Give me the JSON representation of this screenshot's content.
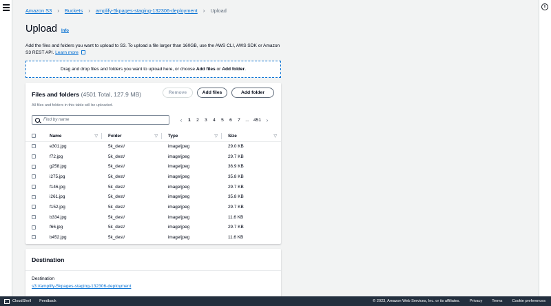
{
  "breadcrumb": {
    "items": [
      "Amazon S3",
      "Buckets",
      "amplify-5kpages-staging-132306-deployment"
    ],
    "current": "Upload"
  },
  "page": {
    "title": "Upload",
    "info": "Info",
    "description": "Add the files and folders you want to upload to S3. To upload a file larger than 160GB, use the AWS CLI, AWS SDK or Amazon S3 REST API.",
    "learn_more": "Learn more"
  },
  "dropzone": {
    "text_before": "Drag and drop files and folders you want to upload here, or choose ",
    "add_files": "Add files",
    "or": " or ",
    "add_folder": "Add folder",
    "period": "."
  },
  "files_panel": {
    "title": "Files and folders",
    "count": "(4501 Total, 127.9 MB)",
    "subtitle": "All files and folders in this table will be uploaded.",
    "buttons": {
      "remove": "Remove",
      "add_files": "Add files",
      "add_folder": "Add folder"
    },
    "search_placeholder": "Find by name",
    "pagination": {
      "pages": [
        "1",
        "2",
        "3",
        "4",
        "5",
        "6",
        "7"
      ],
      "ellipsis": "...",
      "last": "451",
      "current": "1"
    },
    "columns": [
      "Name",
      "Folder",
      "Type",
      "Size"
    ],
    "rows": [
      {
        "name": "e301.jpg",
        "folder": "5k_dest/",
        "type": "image/jpeg",
        "size": "29.0 KB"
      },
      {
        "name": "f72.jpg",
        "folder": "5k_dest/",
        "type": "image/jpeg",
        "size": "29.7 KB"
      },
      {
        "name": "g258.jpg",
        "folder": "5k_dest/",
        "type": "image/jpeg",
        "size": "36.9 KB"
      },
      {
        "name": "i275.jpg",
        "folder": "5k_dest/",
        "type": "image/jpeg",
        "size": "35.8 KB"
      },
      {
        "name": "f146.jpg",
        "folder": "5k_dest/",
        "type": "image/jpeg",
        "size": "29.7 KB"
      },
      {
        "name": "i261.jpg",
        "folder": "5k_dest/",
        "type": "image/jpeg",
        "size": "35.8 KB"
      },
      {
        "name": "f152.jpg",
        "folder": "5k_dest/",
        "type": "image/jpeg",
        "size": "29.7 KB"
      },
      {
        "name": "b334.jpg",
        "folder": "5k_dest/",
        "type": "image/jpeg",
        "size": "11.6 KB"
      },
      {
        "name": "f66.jpg",
        "folder": "5k_dest/",
        "type": "image/jpeg",
        "size": "29.7 KB"
      },
      {
        "name": "b452.jpg",
        "folder": "5k_dest/",
        "type": "image/jpeg",
        "size": "11.6 KB"
      }
    ]
  },
  "destination": {
    "title": "Destination",
    "label": "Destination",
    "link": "s3://amplify-5kpages-staging-132306-deployment"
  },
  "footer": {
    "cloudshell": "CloudShell",
    "feedback": "Feedback",
    "copyright": "© 2023, Amazon Web Services, Inc. or its affiliates.",
    "privacy": "Privacy",
    "terms": "Terms",
    "cookies": "Cookie preferences"
  },
  "icons": {
    "menu": "hamburger-menu-icon",
    "info": "info-circle-icon",
    "search": "search-icon",
    "sort": "sort-caret-icon",
    "external": "external-link-icon",
    "cloudshell": "terminal-icon"
  },
  "colors": {
    "link": "#0972d3",
    "footer_bg": "#232f3e",
    "page_bg": "#f2f3f3"
  }
}
